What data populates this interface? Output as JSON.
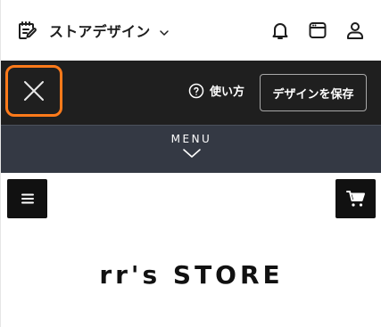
{
  "header": {
    "title": "ストアデザイン",
    "icons": [
      "edit-note-icon",
      "chevron-down-icon",
      "bell-icon",
      "window-icon",
      "user-icon"
    ]
  },
  "toolbar": {
    "close_icon": "close-icon",
    "howto_label": "使い方",
    "save_label": "デザインを保存",
    "highlight_color": "#ff7a1a"
  },
  "menu": {
    "label": "MENU",
    "icon": "chevron-down-icon"
  },
  "store": {
    "title": "rr's STORE",
    "left_icon": "hamburger-icon",
    "right_icon": "cart-icon"
  },
  "colors": {
    "toolbar_bg": "#1f1f1f",
    "menubar_bg": "#343944",
    "accent": "#ff7a1a"
  }
}
